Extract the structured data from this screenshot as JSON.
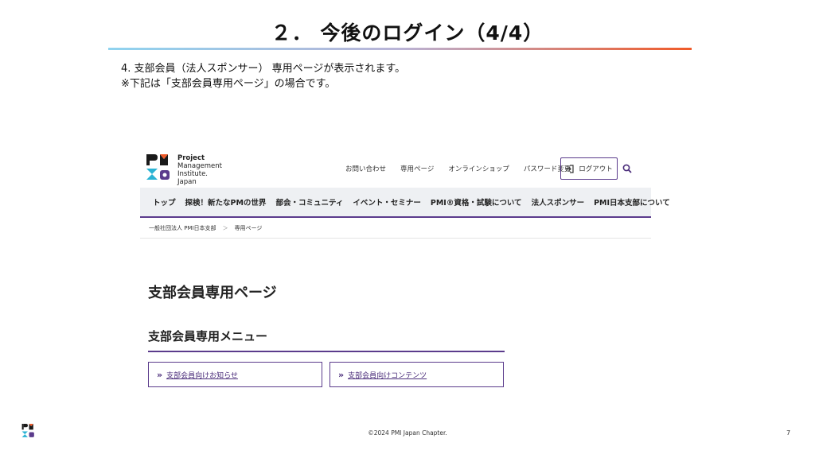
{
  "slide": {
    "title": "２． 今後のログイン（4/4）",
    "line1": "4. 支部会員（法人スポンサー） 専用ページが表示されます。",
    "line2": "※下記は「支部会員専用ページ」の場合です。"
  },
  "website": {
    "logo": {
      "mark_text": "PMI",
      "line1": "Project",
      "line2": "Management",
      "line3": "Institute.",
      "line4": "Japan"
    },
    "util_nav": [
      "お問い合わせ",
      "専用ページ",
      "オンラインショップ",
      "パスワード変更"
    ],
    "logout_label": "ログアウト",
    "main_nav": [
      "トップ",
      "探検！新たなPMの世界",
      "部会・コミュニティ",
      "イベント・セミナー",
      "PMI®資格・試験について",
      "法人スポンサー",
      "PMI日本支部について"
    ],
    "breadcrumb": {
      "root": "一般社団法人 PMI日本支部",
      "separator": "＞",
      "current": "専用ページ"
    },
    "page_title": "支部会員専用ページ",
    "menu_title": "支部会員専用メニュー",
    "menu_cards": [
      {
        "chevron": "»",
        "label": "支部会員向けお知らせ"
      },
      {
        "chevron": "»",
        "label": "支部会員向けコンテンツ"
      }
    ]
  },
  "footer": {
    "copyright": "©2024 PMI Japan Chapter.",
    "page_number": "7"
  },
  "colors": {
    "brand_purple": "#5b3b8c",
    "accent_orange": "#f05a28",
    "accent_cyan": "#8fd3ef"
  }
}
